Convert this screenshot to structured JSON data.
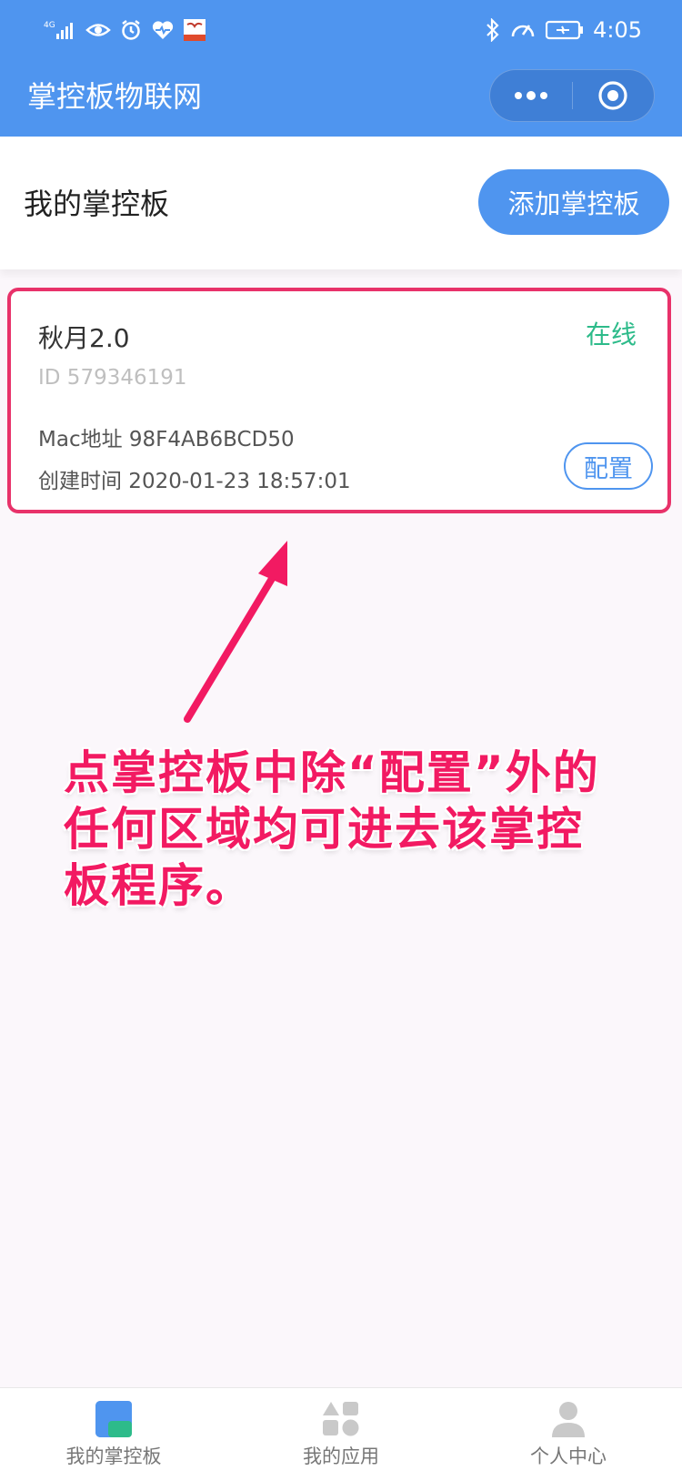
{
  "status_bar": {
    "network": "4G",
    "time": "4:05"
  },
  "nav": {
    "title": "掌控板物联网"
  },
  "header": {
    "title": "我的掌控板",
    "add_button": "添加掌控板"
  },
  "board": {
    "name": "秋月2.0",
    "status": "在线",
    "id": "ID 579346191",
    "mac": "Mac地址 98F4AB6BCD50",
    "created": "创建时间 2020-01-23 18:57:01",
    "config_button": "配置"
  },
  "annotation": {
    "text": "点掌控板中除“配置”外的任何区域均可进去该掌控板程序。"
  },
  "tabbar": {
    "tabs": [
      {
        "label": "我的掌控板",
        "icon": "board-icon",
        "active": true
      },
      {
        "label": "我的应用",
        "icon": "apps-icon",
        "active": false
      },
      {
        "label": "个人中心",
        "icon": "user-icon",
        "active": false
      }
    ]
  },
  "colors": {
    "primary": "#4f95ef",
    "online": "#2dbb8a",
    "annotation": "#f21a62",
    "tab_active": "#4f95ef",
    "tab_active_accent": "#2dbb8a"
  }
}
